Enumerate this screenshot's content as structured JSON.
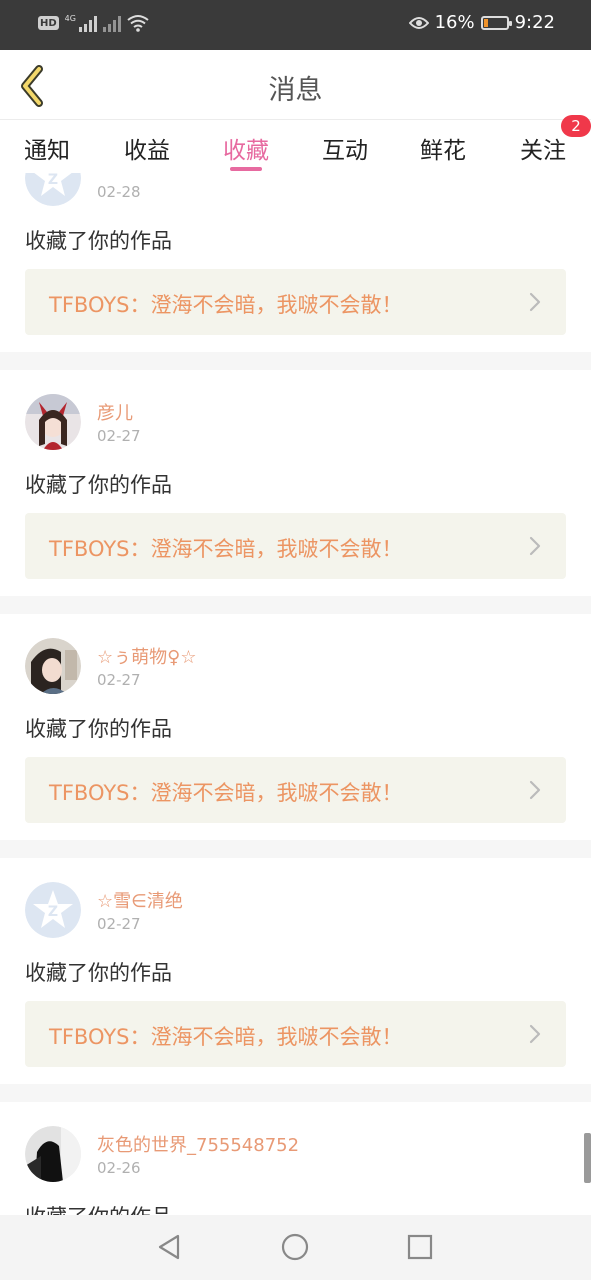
{
  "status_bar": {
    "hd": "HD",
    "network": "4G",
    "eye_icon": "eye-icon",
    "battery_percent": "16%",
    "battery_level": 0.16,
    "time": "9:22"
  },
  "header": {
    "back_icon": "chevron-left-icon",
    "title": "消息"
  },
  "tabs": [
    {
      "label": "通知",
      "active": false
    },
    {
      "label": "收益",
      "active": false
    },
    {
      "label": "收藏",
      "active": true
    },
    {
      "label": "互动",
      "active": false
    },
    {
      "label": "鲜花",
      "active": false
    },
    {
      "label": "关注",
      "active": false,
      "badge": "2"
    }
  ],
  "messages": [
    {
      "username": "",
      "date": "02-28",
      "action": "收藏了你的作品",
      "work": "TFBOYS：澄海不会暗，我啵不会散！",
      "avatar": "default-avatar-icon"
    },
    {
      "username": "彦儿",
      "date": "02-27",
      "action": "收藏了你的作品",
      "work": "TFBOYS：澄海不会暗，我啵不会散！",
      "avatar": "user-avatar"
    },
    {
      "username": "☆ぅ萌物♀☆",
      "date": "02-27",
      "action": "收藏了你的作品",
      "work": "TFBOYS：澄海不会暗，我啵不会散！",
      "avatar": "user-avatar"
    },
    {
      "username": "☆雪∈清绝",
      "date": "02-27",
      "action": "收藏了你的作品",
      "work": "TFBOYS：澄海不会暗，我啵不会散！",
      "avatar": "default-avatar-icon"
    },
    {
      "username": "灰色的世界_755548752",
      "date": "02-26",
      "action": "收藏了你的作品",
      "work": "",
      "avatar": "user-avatar"
    }
  ],
  "system_nav": {
    "back": "triangle-back-icon",
    "home": "circle-home-icon",
    "recents": "square-recents-icon"
  },
  "colors": {
    "accent": "#e76aa0",
    "username": "#e89a76",
    "work_title": "#ec9563",
    "work_box_bg": "#f4f4ec",
    "badge": "#f0384a",
    "status_bar_bg": "#3a3a3a"
  }
}
